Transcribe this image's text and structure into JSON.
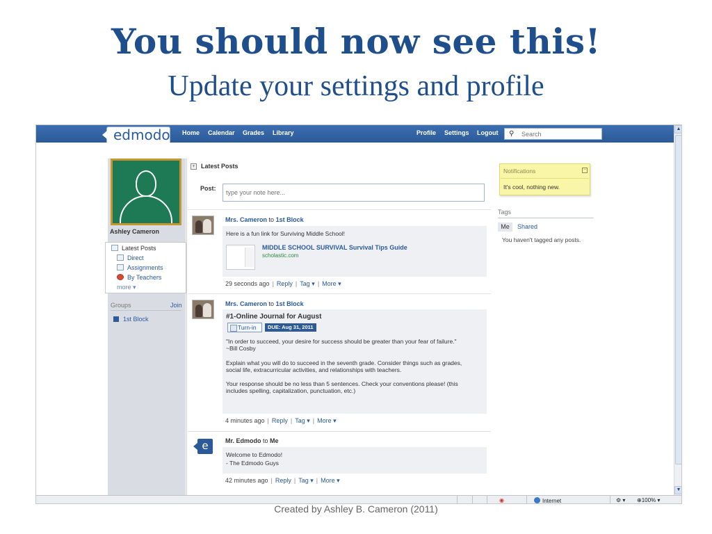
{
  "slide": {
    "title": "You should now see this!",
    "subtitle": "Update your settings and profile",
    "footer": "Created by Ashley B. Cameron (2011)"
  },
  "app": {
    "logo": "edmodo",
    "nav": [
      "Home",
      "Calendar",
      "Grades",
      "Library"
    ],
    "nav_right": [
      "Profile",
      "Settings",
      "Logout"
    ],
    "search_placeholder": "Search"
  },
  "profile": {
    "name": "Ashley Cameron",
    "menu": {
      "latest_posts": "Latest Posts",
      "direct": "Direct",
      "assignments": "Assignments",
      "by_teachers": "By Teachers",
      "more": "more"
    },
    "groups_label": "Groups",
    "join_label": "Join",
    "groups": [
      "1st Block"
    ]
  },
  "feed": {
    "header": "Latest Posts",
    "post_label": "Post:",
    "post_placeholder": "type your note here...",
    "posts": [
      {
        "author": "Mrs. Cameron",
        "to_word": "to",
        "target": "1st Block",
        "text": "Here is a fun link for Surviving Middle School!",
        "link_title": "MIDDLE SCHOOL SURVIVAL Survival Tips Guide",
        "link_url": "scholastic.com",
        "time": "29 seconds ago"
      },
      {
        "author": "Mrs. Cameron",
        "to_word": "to",
        "target": "1st Block",
        "assignment_title": "#1-Online Journal for August",
        "turn_in": "Turn-in",
        "due": "DUE: Aug 31, 2011",
        "p1a": "\"In order to succeed, your desire for success should be greater than your fear of failure.\"",
        "p1b": "~Bill Cosby",
        "p2a": "Explain what you will do to succeed in the seventh grade. Consider things such as grades,",
        "p2b": "social life, extracurricular activities, and relationships with teachers.",
        "p3a": "Your response should be no less than 5 sentences. Check your conventions please! (this",
        "p3b": "includes spelling, capitalization, punctuation, etc.)",
        "time": "4 minutes ago"
      },
      {
        "author": "Mr. Edmodo",
        "to_word": "to",
        "target": "Me",
        "line1": "Welcome to Edmodo!",
        "line2": "- The Edmodo Guys",
        "time": "42 minutes ago"
      }
    ],
    "actions": {
      "reply": "Reply",
      "tag": "Tag",
      "more": "More"
    }
  },
  "sidebar": {
    "notifications_title": "Notifications",
    "notifications_text": "It's cool, nothing new.",
    "tags_title": "Tags",
    "tag_me": "Me",
    "tag_shared": "Shared",
    "tags_empty": "You haven't tagged any posts."
  },
  "statusbar": {
    "zone": "Internet",
    "zoom": "100%"
  },
  "colors": {
    "accent": "#2c5a98",
    "slide_title": "#1f4e8c",
    "notification_bg": "#faf6a8"
  }
}
